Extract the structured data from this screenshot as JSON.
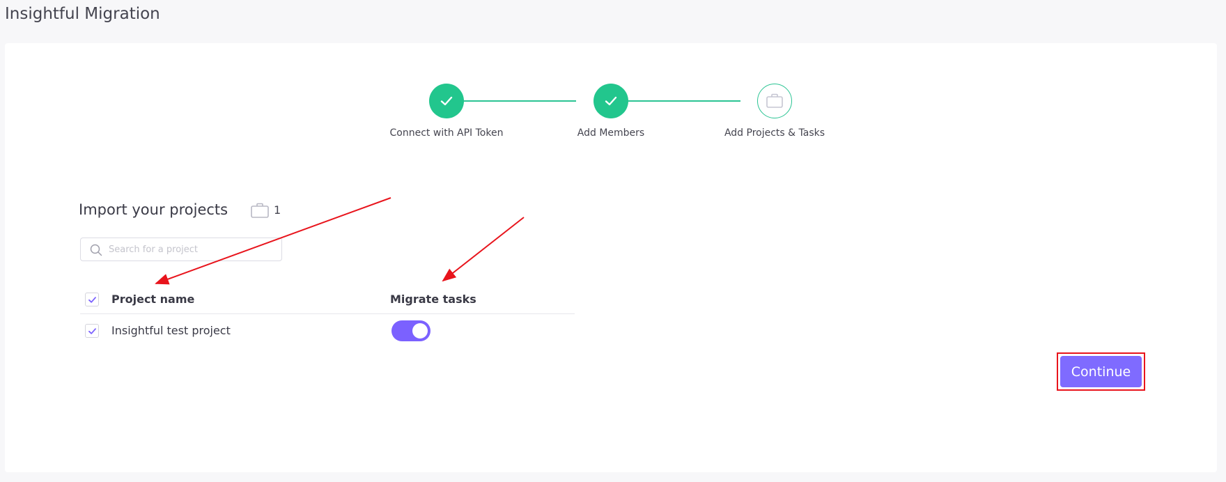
{
  "page": {
    "title": "Insightful Migration"
  },
  "stepper": {
    "steps": [
      {
        "label": "Connect with API Token",
        "status": "completed",
        "icon": "check-icon"
      },
      {
        "label": "Add Members",
        "status": "completed",
        "icon": "check-icon"
      },
      {
        "label": "Add Projects & Tasks",
        "status": "current",
        "icon": "briefcase-icon"
      }
    ],
    "accent_color": "#22c68d"
  },
  "import": {
    "title": "Import your projects",
    "count_icon": "briefcase-icon",
    "count": "1",
    "search": {
      "placeholder": "Search for a project",
      "value": "",
      "icon": "search-icon"
    },
    "table": {
      "columns": [
        "Project name",
        "Migrate tasks"
      ],
      "select_all_checked": true,
      "rows": [
        {
          "name": "Insightful test project",
          "checked": true,
          "migrate_tasks": true
        }
      ]
    }
  },
  "actions": {
    "continue_label": "Continue",
    "button_color": "#7f6bff",
    "highlight_color": "#e8141c"
  },
  "annotations": {
    "arrow_color": "#e8141c",
    "arrows": [
      "pointing-to-project-name-header",
      "pointing-to-migrate-tasks-header"
    ]
  }
}
